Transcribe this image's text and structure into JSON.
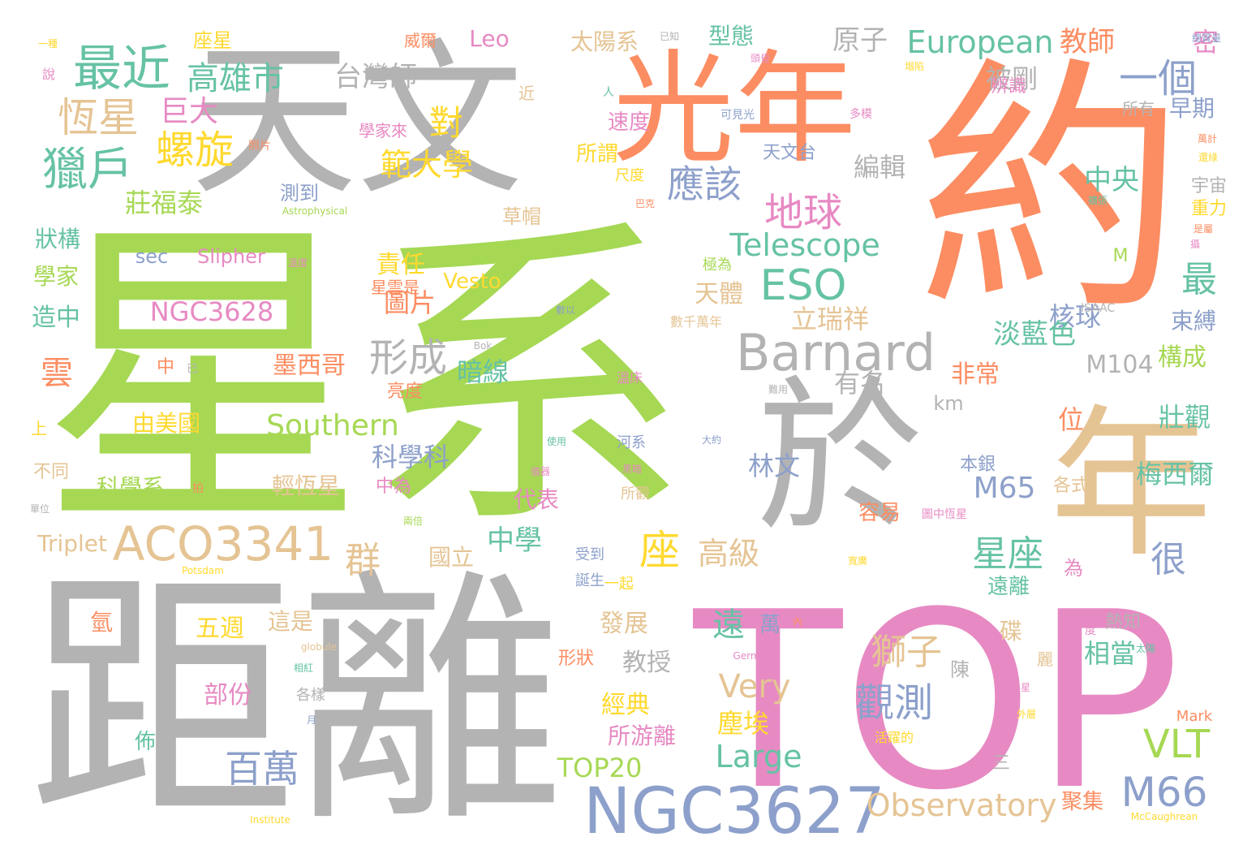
{
  "palette": {
    "green": "#a6d854",
    "gray": "#b3b3b3",
    "orange": "#fc8d62",
    "tan": "#e5c494",
    "pink": "#e78ac3",
    "blue": "#8da0cb",
    "teal": "#66c2a5",
    "yellow": "#ffd92f"
  },
  "words": [
    {
      "text": "星系",
      "color": "green"
    },
    {
      "text": "約",
      "color": "orange"
    },
    {
      "text": "距離",
      "color": "gray"
    },
    {
      "text": "TOP",
      "color": "pink"
    },
    {
      "text": "天文",
      "color": "gray"
    },
    {
      "text": "於",
      "color": "gray"
    },
    {
      "text": "年",
      "color": "tan"
    },
    {
      "text": "光年",
      "color": "orange"
    },
    {
      "text": "NGC3627",
      "color": "blue"
    },
    {
      "text": "Barnard",
      "color": "gray"
    },
    {
      "text": "ACO3341",
      "color": "tan"
    },
    {
      "text": "最近",
      "color": "teal"
    },
    {
      "text": "獵戶",
      "color": "teal"
    },
    {
      "text": "恆星",
      "color": "tan"
    },
    {
      "text": "螺旋",
      "color": "yellow"
    },
    {
      "text": "高雄市",
      "color": "teal"
    },
    {
      "text": "巨大",
      "color": "pink"
    },
    {
      "text": "台灣師",
      "color": "gray"
    },
    {
      "text": "對",
      "color": "yellow"
    },
    {
      "text": "範大學",
      "color": "yellow"
    },
    {
      "text": "應該",
      "color": "blue"
    },
    {
      "text": "地球",
      "color": "pink"
    },
    {
      "text": "ESO",
      "color": "teal"
    },
    {
      "text": "Telescope",
      "color": "teal"
    },
    {
      "text": "European",
      "color": "teal"
    },
    {
      "text": "教師",
      "color": "orange"
    },
    {
      "text": "一個",
      "color": "blue"
    },
    {
      "text": "原子",
      "color": "gray"
    },
    {
      "text": "被剛",
      "color": "gray"
    },
    {
      "text": "辨識",
      "color": "pink"
    },
    {
      "text": "密",
      "color": "pink"
    },
    {
      "text": "早期",
      "color": "blue"
    },
    {
      "text": "所有",
      "color": "gray"
    },
    {
      "text": "中央",
      "color": "teal"
    },
    {
      "text": "宇宙",
      "color": "gray"
    },
    {
      "text": "重力",
      "color": "yellow"
    },
    {
      "text": "最",
      "color": "teal"
    },
    {
      "text": "M",
      "color": "green"
    },
    {
      "text": "核球",
      "color": "blue"
    },
    {
      "text": "淡藍色",
      "color": "teal"
    },
    {
      "text": "束縛",
      "color": "blue"
    },
    {
      "text": "構成",
      "color": "green"
    },
    {
      "text": "M104",
      "color": "gray"
    },
    {
      "text": "非常",
      "color": "orange"
    },
    {
      "text": "km",
      "color": "gray"
    },
    {
      "text": "壯觀",
      "color": "teal"
    },
    {
      "text": "位",
      "color": "orange"
    },
    {
      "text": "梅西爾",
      "color": "teal"
    },
    {
      "text": "各式",
      "color": "tan"
    },
    {
      "text": "本銀",
      "color": "blue"
    },
    {
      "text": "M65",
      "color": "blue"
    },
    {
      "text": "容易",
      "color": "orange"
    },
    {
      "text": "星座",
      "color": "teal"
    },
    {
      "text": "很",
      "color": "blue"
    },
    {
      "text": "為",
      "color": "pink"
    },
    {
      "text": "遠離",
      "color": "teal"
    },
    {
      "text": "碟",
      "color": "tan"
    },
    {
      "text": "熱知",
      "color": "gray"
    },
    {
      "text": "相當",
      "color": "teal"
    },
    {
      "text": "陳",
      "color": "gray"
    },
    {
      "text": "VLT",
      "color": "green"
    },
    {
      "text": "三",
      "color": "gray"
    },
    {
      "text": "M66",
      "color": "blue"
    },
    {
      "text": "聚集",
      "color": "orange"
    },
    {
      "text": "Observatory",
      "color": "tan"
    },
    {
      "text": "Mark",
      "color": "orange"
    },
    {
      "text": "觀測",
      "color": "blue"
    },
    {
      "text": "獅子",
      "color": "tan"
    },
    {
      "text": "Very",
      "color": "tan"
    },
    {
      "text": "塵埃",
      "color": "yellow"
    },
    {
      "text": "Large",
      "color": "teal"
    },
    {
      "text": "萬",
      "color": "blue"
    },
    {
      "text": "遠",
      "color": "teal"
    },
    {
      "text": "座",
      "color": "yellow"
    },
    {
      "text": "高級",
      "color": "tan"
    },
    {
      "text": "林文",
      "color": "blue"
    },
    {
      "text": "立瑞祥",
      "color": "tan"
    },
    {
      "text": "天體",
      "color": "tan"
    },
    {
      "text": "有名",
      "color": "gray"
    },
    {
      "text": "編輯",
      "color": "gray"
    },
    {
      "text": "形成",
      "color": "gray"
    },
    {
      "text": "暗線",
      "color": "teal"
    },
    {
      "text": "Southern",
      "color": "green"
    },
    {
      "text": "科學科",
      "color": "blue"
    },
    {
      "text": "中學",
      "color": "teal"
    },
    {
      "text": "代表",
      "color": "pink"
    },
    {
      "text": "國立",
      "color": "tan"
    },
    {
      "text": "發展",
      "color": "tan"
    },
    {
      "text": "教授",
      "color": "gray"
    },
    {
      "text": "經典",
      "color": "yellow"
    },
    {
      "text": "所游離",
      "color": "pink"
    },
    {
      "text": "TOP20",
      "color": "green"
    },
    {
      "text": "百萬",
      "color": "blue"
    },
    {
      "text": "部份",
      "color": "pink"
    },
    {
      "text": "五週",
      "color": "yellow"
    },
    {
      "text": "這是",
      "color": "tan"
    },
    {
      "text": "群",
      "color": "tan"
    },
    {
      "text": "NGC3628",
      "color": "pink"
    },
    {
      "text": "圖片",
      "color": "orange"
    },
    {
      "text": "責任",
      "color": "yellow"
    },
    {
      "text": "Vesto",
      "color": "yellow"
    },
    {
      "text": "墨西哥",
      "color": "orange"
    },
    {
      "text": "亮度",
      "color": "orange"
    },
    {
      "text": "由美國",
      "color": "yellow"
    },
    {
      "text": "輕恆星",
      "color": "tan"
    },
    {
      "text": "中為",
      "color": "pink"
    },
    {
      "text": "科學系",
      "color": "green"
    },
    {
      "text": "Triplet",
      "color": "tan"
    },
    {
      "text": "雲",
      "color": "orange"
    },
    {
      "text": "造中",
      "color": "teal"
    },
    {
      "text": "學家",
      "color": "green"
    },
    {
      "text": "狀構",
      "color": "teal"
    },
    {
      "text": "莊福泰",
      "color": "green"
    },
    {
      "text": "sec",
      "color": "blue"
    },
    {
      "text": "Slipher",
      "color": "pink"
    },
    {
      "text": "測到",
      "color": "blue"
    },
    {
      "text": "Astrophysical",
      "color": "green"
    },
    {
      "text": "草帽",
      "color": "tan"
    },
    {
      "text": "太陽系",
      "color": "tan"
    },
    {
      "text": "型態",
      "color": "teal"
    },
    {
      "text": "Leo",
      "color": "pink"
    },
    {
      "text": "威爾",
      "color": "orange"
    },
    {
      "text": "座星",
      "color": "yellow"
    },
    {
      "text": "一種",
      "color": "yellow"
    },
    {
      "text": "說",
      "color": "pink"
    },
    {
      "text": "近",
      "color": "tan"
    },
    {
      "text": "學家來",
      "color": "pink"
    },
    {
      "text": "照片",
      "color": "orange"
    },
    {
      "text": "所謂",
      "color": "yellow"
    },
    {
      "text": "速度",
      "color": "pink"
    },
    {
      "text": "人",
      "color": "teal"
    },
    {
      "text": "尺度",
      "color": "yellow"
    },
    {
      "text": "天文台",
      "color": "blue"
    },
    {
      "text": "可見光",
      "color": "blue"
    },
    {
      "text": "多模",
      "color": "pink"
    },
    {
      "text": "已知",
      "color": "gray"
    },
    {
      "text": "頭昏",
      "color": "pink"
    },
    {
      "text": "塌陷",
      "color": "yellow"
    },
    {
      "text": "總質量",
      "color": "blue"
    },
    {
      "text": "巴克",
      "color": "orange"
    },
    {
      "text": "溫度",
      "color": "pink"
    },
    {
      "text": "極為",
      "color": "green"
    },
    {
      "text": "星雲是",
      "color": "orange"
    },
    {
      "text": "數以",
      "color": "blue"
    },
    {
      "text": "數千萬年",
      "color": "tan"
    },
    {
      "text": "Bok",
      "color": "gray"
    },
    {
      "text": "溫床",
      "color": "pink"
    },
    {
      "text": "難用",
      "color": "gray"
    },
    {
      "text": "大約",
      "color": "blue"
    },
    {
      "text": "河系",
      "color": "blue"
    },
    {
      "text": "使用",
      "color": "teal"
    },
    {
      "text": "黑暗",
      "color": "pink"
    },
    {
      "text": "儀器",
      "color": "pink"
    },
    {
      "text": "所觀",
      "color": "tan"
    },
    {
      "text": "圖中恆星",
      "color": "pink"
    },
    {
      "text": "受到",
      "color": "blue"
    },
    {
      "text": "誕生",
      "color": "blue"
    },
    {
      "text": "一起",
      "color": "yellow"
    },
    {
      "text": "寬廣",
      "color": "yellow"
    },
    {
      "text": "內",
      "color": "orange"
    },
    {
      "text": "Germany",
      "color": "pink"
    },
    {
      "text": "Potsdam",
      "color": "yellow"
    },
    {
      "text": "globule",
      "color": "tan"
    },
    {
      "text": "相紅",
      "color": "teal"
    },
    {
      "text": "月",
      "color": "blue"
    },
    {
      "text": "佈",
      "color": "teal"
    },
    {
      "text": "各樣",
      "color": "gray"
    },
    {
      "text": "Institute",
      "color": "yellow"
    },
    {
      "text": "活躍的",
      "color": "yellow"
    },
    {
      "text": "氫",
      "color": "orange"
    },
    {
      "text": "中",
      "color": "orange"
    },
    {
      "text": "已",
      "color": "gray"
    },
    {
      "text": "上",
      "color": "yellow"
    },
    {
      "text": "不同",
      "color": "tan"
    },
    {
      "text": "拍",
      "color": "orange"
    },
    {
      "text": "兩倍",
      "color": "green"
    },
    {
      "text": "單位",
      "color": "gray"
    },
    {
      "text": "形狀",
      "color": "orange"
    },
    {
      "text": "外層",
      "color": "yellow"
    },
    {
      "text": "McCaughrean",
      "color": "yellow"
    },
    {
      "text": "度",
      "color": "pink"
    },
    {
      "text": "球",
      "color": "pink"
    },
    {
      "text": "太陽",
      "color": "teal"
    },
    {
      "text": "星",
      "color": "pink"
    },
    {
      "text": "麗",
      "color": "tan"
    },
    {
      "text": "ISAAC",
      "color": "gray"
    },
    {
      "text": "攝",
      "color": "pink"
    },
    {
      "text": "是屬",
      "color": "orange"
    },
    {
      "text": "擴張",
      "color": "teal"
    },
    {
      "text": "萬計",
      "color": "orange"
    },
    {
      "text": "還綠",
      "color": "yellow"
    }
  ]
}
